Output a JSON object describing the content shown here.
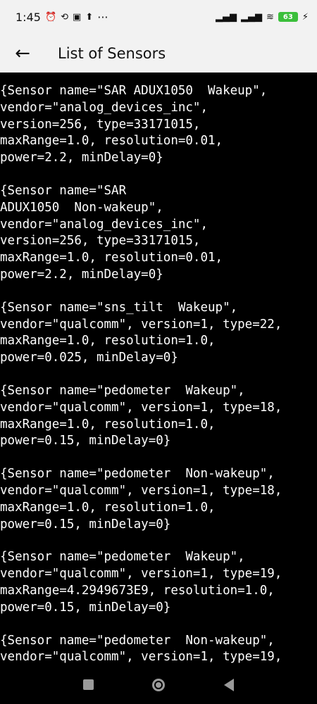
{
  "status_bar": {
    "time": "1:45",
    "icons_left": [
      "alarm-icon",
      "sync-icon",
      "data-icon",
      "upload-icon"
    ],
    "more": "···",
    "battery": "63"
  },
  "app_bar": {
    "title": "List of Sensors",
    "back_icon": "←"
  },
  "sensors": [
    "{Sensor name=\"SAR ADUX1050  Wakeup\",\nvendor=\"analog_devices_inc\",\nversion=256, type=33171015,\nmaxRange=1.0, resolution=0.01,\npower=2.2, minDelay=0}",
    "{Sensor name=\"SAR\nADUX1050  Non-wakeup\",\nvendor=\"analog_devices_inc\",\nversion=256, type=33171015,\nmaxRange=1.0, resolution=0.01,\npower=2.2, minDelay=0}",
    "{Sensor name=\"sns_tilt  Wakeup\",\nvendor=\"qualcomm\", version=1, type=22,\nmaxRange=1.0, resolution=1.0,\npower=0.025, minDelay=0}",
    "{Sensor name=\"pedometer  Wakeup\",\nvendor=\"qualcomm\", version=1, type=18,\nmaxRange=1.0, resolution=1.0,\npower=0.15, minDelay=0}",
    "{Sensor name=\"pedometer  Non-wakeup\",\nvendor=\"qualcomm\", version=1, type=18,\nmaxRange=1.0, resolution=1.0,\npower=0.15, minDelay=0}",
    "{Sensor name=\"pedometer  Wakeup\",\nvendor=\"qualcomm\", version=1, type=19,\nmaxRange=4.2949673E9, resolution=1.0,\npower=0.15, minDelay=0}",
    "{Sensor name=\"pedometer  Non-wakeup\",\nvendor=\"qualcomm\", version=1, type=19,"
  ],
  "nav": {
    "recents": "recents-icon",
    "home": "home-icon",
    "back": "back-icon"
  }
}
